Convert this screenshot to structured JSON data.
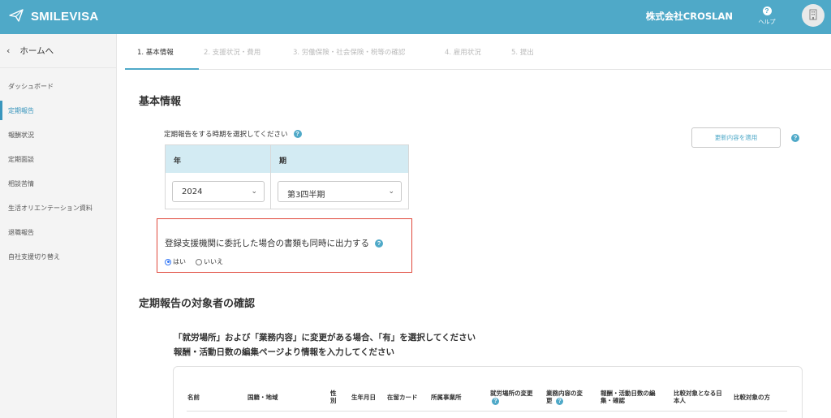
{
  "header": {
    "logo_text": "SMILEVISA",
    "company": "株式会社CROSLAN",
    "help_label": "ヘルプ"
  },
  "sidebar": {
    "home_label": "ホームへ",
    "items": [
      {
        "label": "ダッシュボード"
      },
      {
        "label": "定期報告"
      },
      {
        "label": "報酬状況"
      },
      {
        "label": "定期面談"
      },
      {
        "label": "相談苦情"
      },
      {
        "label": "生活オリエンテーション資料"
      },
      {
        "label": "退職報告"
      },
      {
        "label": "自社支援切り替え"
      }
    ]
  },
  "tabs": [
    {
      "label": "1. 基本情報"
    },
    {
      "label": "2. 支援状況・費用"
    },
    {
      "label": "3. 労働保険・社会保険・税等の確認"
    },
    {
      "label": "4. 雇用状況"
    },
    {
      "label": "5. 提出"
    }
  ],
  "basic_info": {
    "title": "基本情報",
    "period_prompt": "定期報告をする時期を選択してください",
    "col_year": "年",
    "col_period": "期",
    "year_value": "2024",
    "period_value": "第3四半期",
    "apply_button": "更新内容を適用"
  },
  "delegation": {
    "question": "登録支援機関に委託した場合の書類も同時に出力する",
    "yes": "はい",
    "no": "いいえ",
    "selected": "はい"
  },
  "targets": {
    "title": "定期報告の対象者の確認",
    "instruction1": "「就労場所」および「業務内容」に変更がある場合、「有」を選択してください",
    "instruction2": "報酬・活動日数の編集ページより情報を入力してください",
    "columns": {
      "name": "名前",
      "nationality": "国籍・地域",
      "gender": "性別",
      "birthdate": "生年月日",
      "residence_card": "在留カード",
      "office": "所属事業所",
      "workplace_change": "就労場所の変更",
      "duty_change": "業務内容の変更",
      "pay_edit": "報酬・活動日数の編集・確認",
      "comparison_japanese": "比較対象となる日本人",
      "comparison_person": "比較対象の方"
    }
  },
  "colors": {
    "header_bg": "#4fa9c8",
    "accent": "#3a96bd",
    "table_head_bg": "#d3ebf3",
    "highlight_border": "#e0473a"
  }
}
